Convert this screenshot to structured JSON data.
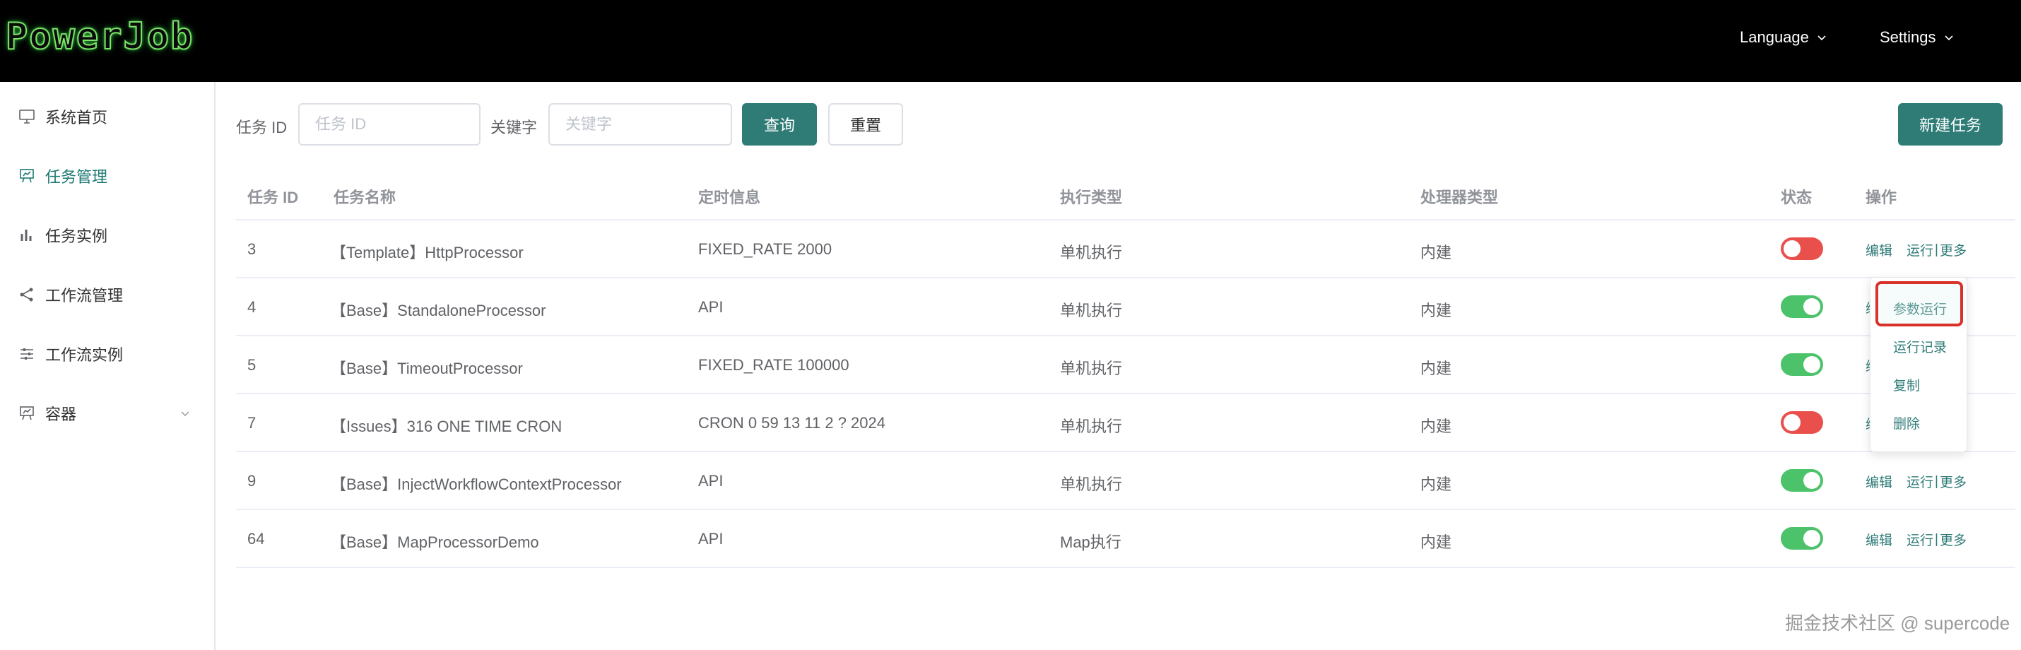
{
  "header": {
    "logo": "PowerJob",
    "language_label": "Language",
    "settings_label": "Settings"
  },
  "sidebar": {
    "items": [
      {
        "label": "系统首页",
        "icon": "monitor-icon"
      },
      {
        "label": "任务管理",
        "icon": "presentation-icon",
        "active": true
      },
      {
        "label": "任务实例",
        "icon": "bar-chart-icon"
      },
      {
        "label": "工作流管理",
        "icon": "share-icon"
      },
      {
        "label": "工作流实例",
        "icon": "sliders-icon"
      },
      {
        "label": "容器",
        "icon": "presentation-icon",
        "has_submenu": true
      }
    ]
  },
  "filters": {
    "task_id_label": "任务 ID",
    "task_id_placeholder": "任务 ID",
    "task_id_value": "",
    "keyword_label": "关键字",
    "keyword_placeholder": "关键字",
    "keyword_value": "",
    "query_button": "查询",
    "reset_button": "重置",
    "new_task_button": "新建任务"
  },
  "table": {
    "columns": [
      "任务 ID",
      "任务名称",
      "定时信息",
      "执行类型",
      "处理器类型",
      "状态",
      "操作"
    ],
    "rows": [
      {
        "id": "3",
        "name": "【Template】HttpProcessor",
        "schedule": "FIXED_RATE 2000",
        "exec_type": "单机执行",
        "processor_type": "内建",
        "enabled": false
      },
      {
        "id": "4",
        "name": "【Base】StandaloneProcessor",
        "schedule": "API",
        "exec_type": "单机执行",
        "processor_type": "内建",
        "enabled": true
      },
      {
        "id": "5",
        "name": "【Base】TimeoutProcessor",
        "schedule": "FIXED_RATE 100000",
        "exec_type": "单机执行",
        "processor_type": "内建",
        "enabled": true
      },
      {
        "id": "7",
        "name": "【Issues】316 ONE TIME CRON",
        "schedule": "CRON 0 59 13 11 2 ? 2024",
        "exec_type": "单机执行",
        "processor_type": "内建",
        "enabled": false
      },
      {
        "id": "9",
        "name": "【Base】InjectWorkflowContextProcessor",
        "schedule": "API",
        "exec_type": "单机执行",
        "processor_type": "内建",
        "enabled": true
      },
      {
        "id": "64",
        "name": "【Base】MapProcessorDemo",
        "schedule": "API",
        "exec_type": "Map执行",
        "processor_type": "内建",
        "enabled": true
      }
    ],
    "ops": {
      "edit": "编辑",
      "run": "运行",
      "sep": "|",
      "more": "更多",
      "edit_partial": "编"
    }
  },
  "dropdown": {
    "items": [
      "参数运行",
      "运行记录",
      "复制",
      "删除"
    ],
    "highlighted": "参数运行"
  },
  "colors": {
    "brand": "#2f7c77",
    "switch_on": "#4cc36a",
    "switch_off": "#e9504c",
    "highlight_box": "#d8322b",
    "header_bg": "#000000"
  },
  "watermark": "掘金技术社区 @ supercode"
}
